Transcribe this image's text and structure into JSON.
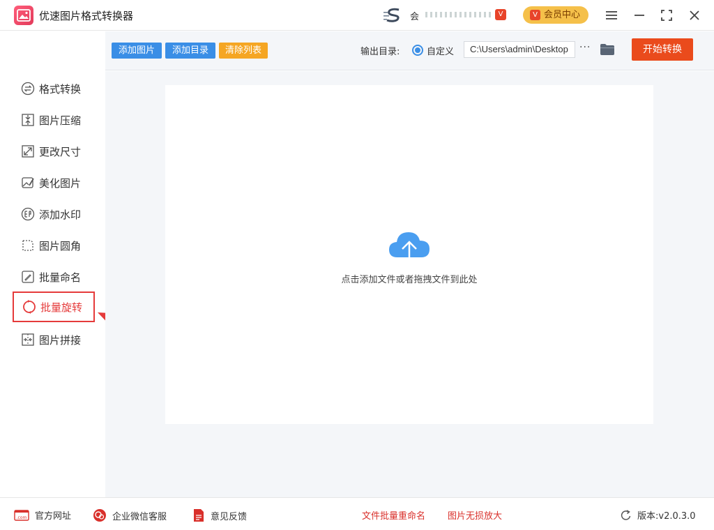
{
  "app": {
    "title": "优速图片格式转换器"
  },
  "user": {
    "label": "会",
    "badge": "V"
  },
  "vip": {
    "label": "会员中心",
    "icon_text": "V"
  },
  "window_controls": [
    "menu-icon",
    "minimize-icon",
    "maximize-icon",
    "close-icon"
  ],
  "sidebar": {
    "items": [
      {
        "label": "格式转换",
        "icon": "format-convert-icon"
      },
      {
        "label": "图片压缩",
        "icon": "compress-icon"
      },
      {
        "label": "更改尺寸",
        "icon": "resize-icon"
      },
      {
        "label": "美化图片",
        "icon": "beautify-icon"
      },
      {
        "label": "添加水印",
        "icon": "watermark-icon"
      },
      {
        "label": "图片圆角",
        "icon": "round-corner-icon"
      },
      {
        "label": "批量命名",
        "icon": "rename-icon"
      },
      {
        "label": "批量旋转",
        "icon": "rotate-icon",
        "active": true
      },
      {
        "label": "图片拼接",
        "icon": "stitch-icon"
      }
    ]
  },
  "toolbar": {
    "add_image": "添加图片",
    "add_folder": "添加目录",
    "clear_list": "清除列表",
    "output_label": "输出目录:",
    "radio_label": "自定义",
    "output_path": "C:\\Users\\admin\\Desktop",
    "more": "···",
    "start": "开始转换"
  },
  "drop_zone": {
    "hint": "点击添加文件或者拖拽文件到此处"
  },
  "footer": {
    "website": "官方网址",
    "wechat": "企业微信客服",
    "feedback": "意见反馈",
    "batch_rename": "文件批量重命名",
    "lossless_enlarge": "图片无损放大",
    "version": "版本:v2.0.3.0"
  },
  "colors": {
    "accent_blue": "#3a8ee6",
    "accent_orange": "#f5a623",
    "start_red": "#ea4b1c",
    "active_red": "#e53a3a"
  }
}
